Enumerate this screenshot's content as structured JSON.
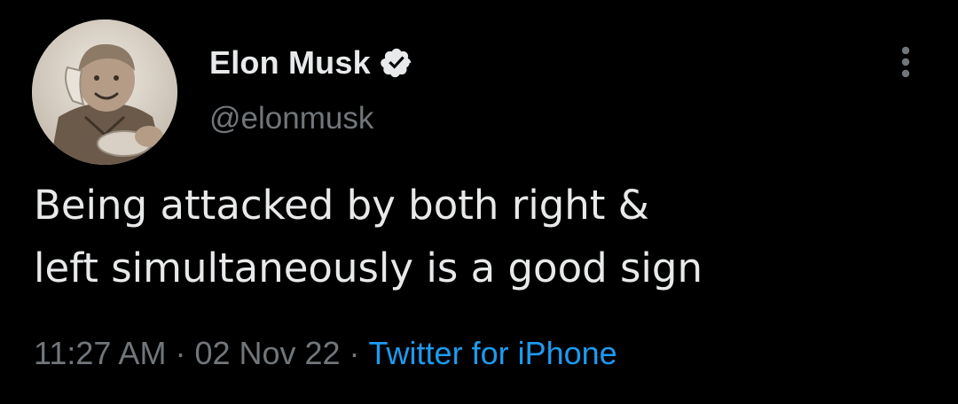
{
  "tweet": {
    "author": {
      "display_name": "Elon Musk",
      "handle": "@elonmusk",
      "verified_icon": "verified-badge-icon",
      "avatar": "avatar-photo"
    },
    "text": "Being attacked by both right &\nleft simultaneously is a good sign",
    "time": "11:27 AM",
    "separator": "·",
    "date": "02 Nov 22",
    "source": "Twitter for iPhone",
    "more_icon": "more-options-icon"
  },
  "colors": {
    "background": "#000000",
    "primary_text": "#e7e9ea",
    "secondary_text": "#71767b",
    "link": "#1d9bf0",
    "verified_badge": "#e7e9ea"
  }
}
